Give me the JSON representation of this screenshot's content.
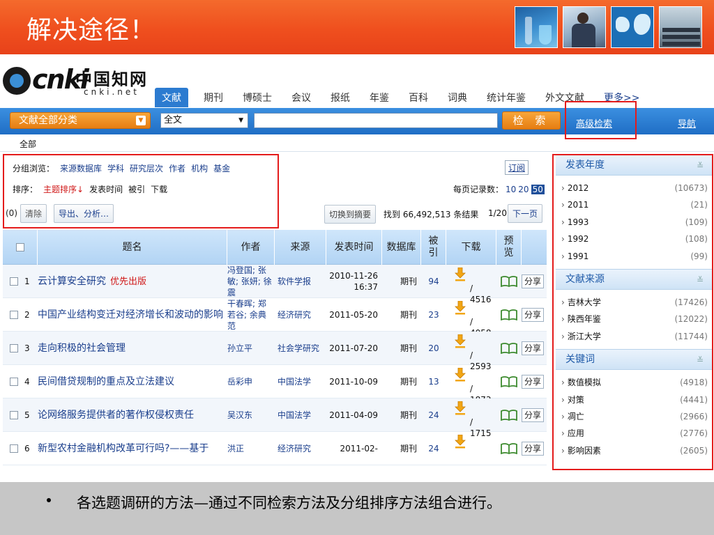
{
  "slide": {
    "title": "解决途径！",
    "caption": "各选题调研的方法—通过不同检索方法及分组排序方法组合进行。"
  },
  "logo": {
    "cnki": "cnki",
    "cn_name": "中国知网",
    "sub": "cnki.net"
  },
  "nav": {
    "tabs": [
      "文献",
      "期刊",
      "博硕士",
      "会议",
      "报纸",
      "年鉴",
      "百科",
      "词典",
      "统计年鉴",
      "外文文献",
      "更多>>"
    ]
  },
  "search": {
    "category": "文献全部分类",
    "field": "全文",
    "query": "",
    "button": "检 索",
    "advanced": "高级检索",
    "guide": "导航"
  },
  "breadcrumb": "全部",
  "toolbar": {
    "browse_label": "分组浏览：",
    "browse_links": [
      "来源数据库",
      "学科",
      "研究层次",
      "作者",
      "机构",
      "基金"
    ],
    "subscribe": "订阅",
    "sort_label": "排序：",
    "sort_active": "主题排序↓",
    "sort_links": [
      "发表时间",
      "被引",
      "下载"
    ],
    "per_page_label": "每页记录数：",
    "per_page_options": [
      "10",
      "20"
    ],
    "per_page_selected": "50",
    "selected_count": "(0)",
    "clear": "清除",
    "export": "导出、分析…",
    "switch": "切换到摘要",
    "found": "找到 66,492,513 条结果",
    "page": "1/20",
    "next": "下一页"
  },
  "table": {
    "headers": {
      "title": "题名",
      "author": "作者",
      "source": "来源",
      "date": "发表时间",
      "db": "数据库",
      "cite": "被引",
      "download": "下载",
      "preview": "预览"
    },
    "rows": [
      {
        "no": "1",
        "title": "云计算安全研究",
        "flag": "优先出版",
        "author": "冯登国; 张敏; 张妍; 徐震",
        "source": "软件学报",
        "date": "2010-11-26 16:37",
        "db": "期刊",
        "cite": "94",
        "downloads": "/ 4516",
        "share": "分享"
      },
      {
        "no": "2",
        "title": "中国产业结构变迁对经济增长和波动的影响",
        "flag": "",
        "author": "干春晖; 郑若谷; 余典范",
        "source": "经济研究",
        "date": "2011-05-20",
        "db": "期刊",
        "cite": "23",
        "downloads": "/ 4058",
        "share": "分享"
      },
      {
        "no": "3",
        "title": "走向积极的社会管理",
        "flag": "",
        "author": "孙立平",
        "source": "社会学研究",
        "date": "2011-07-20",
        "db": "期刊",
        "cite": "20",
        "downloads": "/ 2593",
        "share": "分享"
      },
      {
        "no": "4",
        "title": "民间借贷规制的重点及立法建议",
        "flag": "",
        "author": "岳彩申",
        "source": "中国法学",
        "date": "2011-10-09",
        "db": "期刊",
        "cite": "13",
        "downloads": "/ 1873",
        "share": "分享"
      },
      {
        "no": "5",
        "title": "论网络服务提供者的著作权侵权责任",
        "flag": "",
        "author": "吴汉东",
        "source": "中国法学",
        "date": "2011-04-09",
        "db": "期刊",
        "cite": "24",
        "downloads": "/ 1715",
        "share": "分享"
      },
      {
        "no": "6",
        "title": "新型农村金融机构改革可行吗?——基于",
        "flag": "",
        "author": "洪正",
        "source": "经济研究",
        "date": "2011-02-",
        "db": "期刊",
        "cite": "24",
        "downloads": "",
        "share": "分享"
      }
    ]
  },
  "side": {
    "groups": [
      {
        "title": "发表年度",
        "items": [
          {
            "label": "2012",
            "count": "(10673)"
          },
          {
            "label": "2011",
            "count": "(21)"
          },
          {
            "label": "1993",
            "count": "(109)"
          },
          {
            "label": "1992",
            "count": "(108)"
          },
          {
            "label": "1991",
            "count": "(99)"
          }
        ]
      },
      {
        "title": "文献来源",
        "items": [
          {
            "label": "吉林大学",
            "count": "(17426)"
          },
          {
            "label": "陕西年鉴",
            "count": "(12022)"
          },
          {
            "label": "浙江大学",
            "count": "(11744)"
          }
        ]
      },
      {
        "title": "关键词",
        "items": [
          {
            "label": "数值模拟",
            "count": "(4918)"
          },
          {
            "label": "对策",
            "count": "(4441)"
          },
          {
            "label": "凋亡",
            "count": "(2966)"
          },
          {
            "label": "应用",
            "count": "(2776)"
          },
          {
            "label": "影响因素",
            "count": "(2605)"
          }
        ]
      }
    ],
    "toggle_icon": "double-chevron-down-icon",
    "arrow_icon": "chevron-right-icon"
  },
  "colors": {
    "header": "#ef4f1e",
    "nav_blue": "#2c7bd0",
    "accent_orange": "#e67d12",
    "highlight_red": "#e41b1b",
    "link": "#1a3e8c"
  }
}
